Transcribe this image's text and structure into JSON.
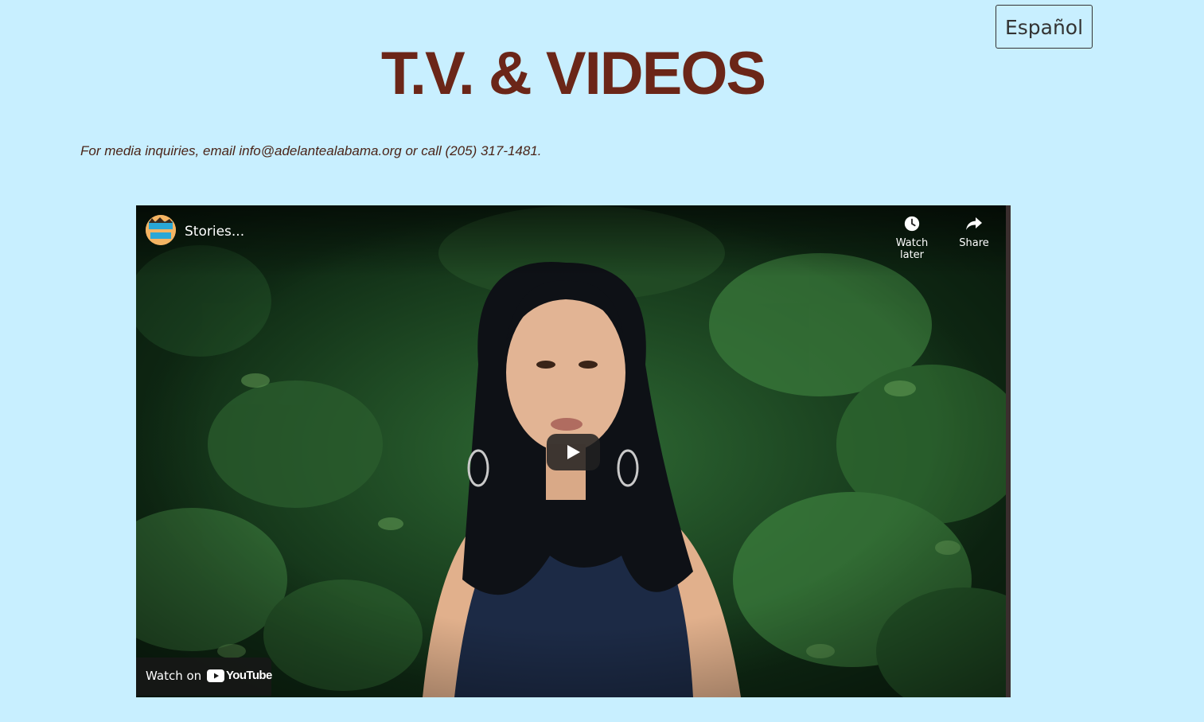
{
  "header": {
    "language_button": "Español",
    "title": "T.V. & VIDEOS"
  },
  "intro": {
    "media_note": "For media inquiries, email info@adelantealabama.org or call (205) 317-1481."
  },
  "video": {
    "title": "Stories...",
    "actions": {
      "watch_later": "Watch later",
      "share": "Share"
    },
    "watch_on_label": "Watch on",
    "platform": "YouTube",
    "icons": [
      "channel-avatar",
      "clock-icon",
      "share-arrow-icon",
      "play-icon",
      "youtube-logo-icon"
    ]
  }
}
